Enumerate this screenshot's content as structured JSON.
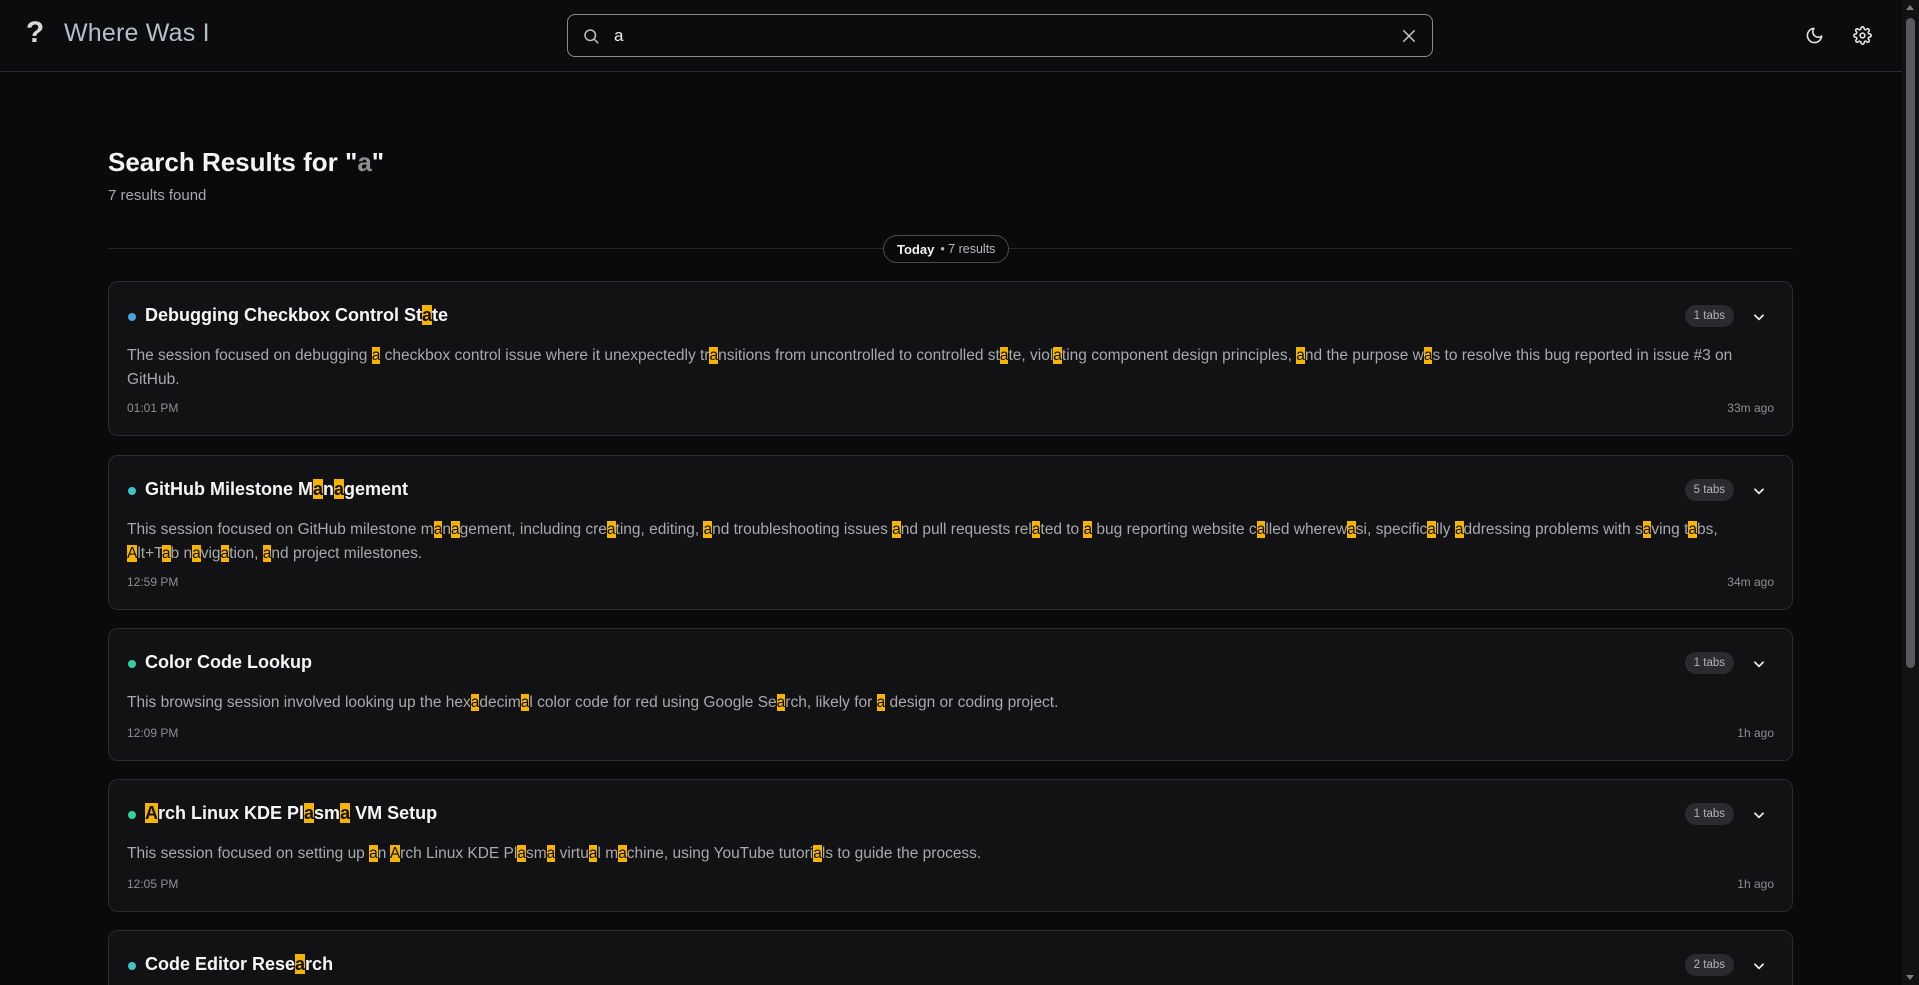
{
  "app": {
    "logo_mark": "?",
    "title": "Where Was I"
  },
  "search": {
    "value": "a",
    "placeholder": ""
  },
  "results": {
    "title_prefix": "Search Results for \"",
    "query": "a",
    "title_suffix": "\"",
    "count_text": "7 results found"
  },
  "day_group": {
    "label": "Today",
    "count_text": "• 7 results"
  },
  "colors": {
    "dot_blue": "#4aa3df",
    "dot_teal": "#3ec4c4",
    "dot_green": "#34d399",
    "highlight": "#f5b400"
  },
  "sessions": [
    {
      "title": "Debugging Checkbox Control State",
      "tabs": "1 tabs",
      "summary": "The session focused on debugging a checkbox control issue where it unexpectedly transitions from uncontrolled to controlled state, violating component design principles, and the purpose was to resolve this bug reported in issue #3 on GitHub.",
      "time": "01:01 PM",
      "ago": "33m ago",
      "dot_color": "#4aa3df"
    },
    {
      "title": "GitHub Milestone Management",
      "tabs": "5 tabs",
      "summary": "This session focused on GitHub milestone management, including creating, editing, and troubleshooting issues and pull requests related to a bug reporting website called wherewasi, specifically addressing problems with saving tabs, Alt+Tab navigation, and project milestones.",
      "time": "12:59 PM",
      "ago": "34m ago",
      "dot_color": "#3ec4c4"
    },
    {
      "title": "Color Code Lookup",
      "tabs": "1 tabs",
      "summary": "This browsing session involved looking up the hexadecimal color code for red using Google Search, likely for a design or coding project.",
      "time": "12:09 PM",
      "ago": "1h ago",
      "dot_color": "#2fd0a8"
    },
    {
      "title": "Arch Linux KDE Plasma VM Setup",
      "tabs": "1 tabs",
      "summary": "This session focused on setting up an Arch Linux KDE Plasma virtual machine, using YouTube tutorials to guide the process.",
      "time": "12:05 PM",
      "ago": "1h ago",
      "dot_color": "#34d399"
    },
    {
      "title": "Code Editor Research",
      "tabs": "2 tabs",
      "summary": "",
      "time": "",
      "ago": "",
      "dot_color": "#3ec4c4"
    }
  ]
}
